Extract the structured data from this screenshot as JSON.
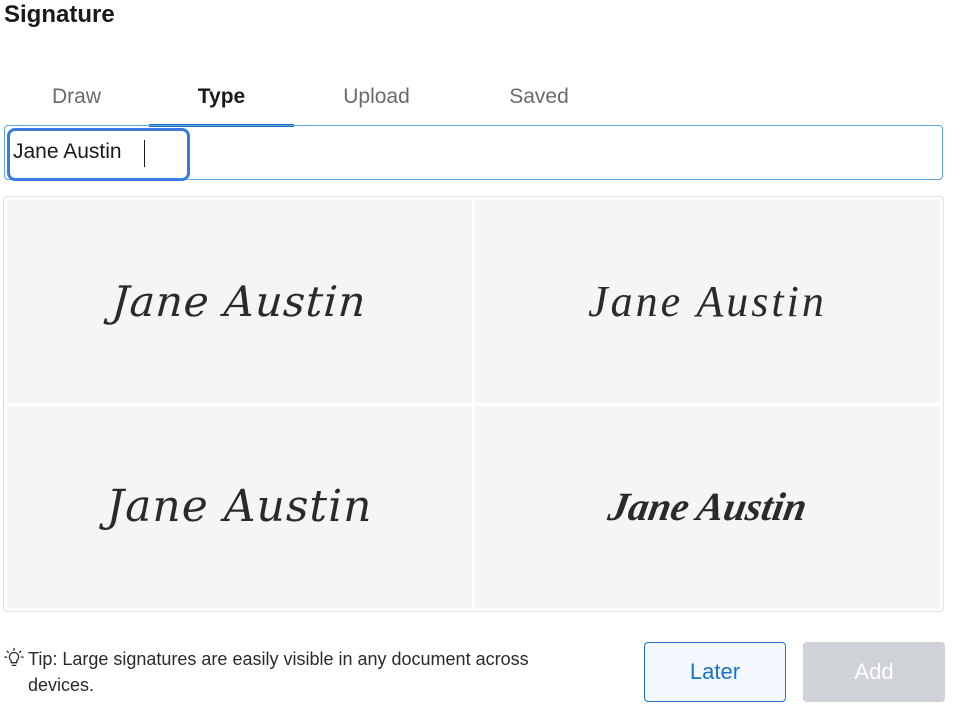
{
  "dialog": {
    "title": "Signature"
  },
  "tabs": [
    {
      "label": "Draw",
      "active": false
    },
    {
      "label": "Type",
      "active": true
    },
    {
      "label": "Upload",
      "active": false
    },
    {
      "label": "Saved",
      "active": false
    }
  ],
  "name_input": {
    "value": "Jane Austin"
  },
  "signatures": [
    {
      "text": "Jane Austin",
      "style": "handwritten-1"
    },
    {
      "text": "Jane Austin",
      "style": "handwritten-2"
    },
    {
      "text": "Jane Austin",
      "style": "handwritten-3"
    },
    {
      "text": "Jane Austin",
      "style": "handwritten-4"
    }
  ],
  "tip": {
    "icon": "lightbulb-icon",
    "text": "Tip: Large signatures are easily visible in any document across devices."
  },
  "buttons": {
    "later": "Later",
    "add": "Add",
    "add_enabled": false
  },
  "colors": {
    "accent": "#1a73c9",
    "focus": "#3a7be0",
    "disabled": "#cfd2d6"
  }
}
